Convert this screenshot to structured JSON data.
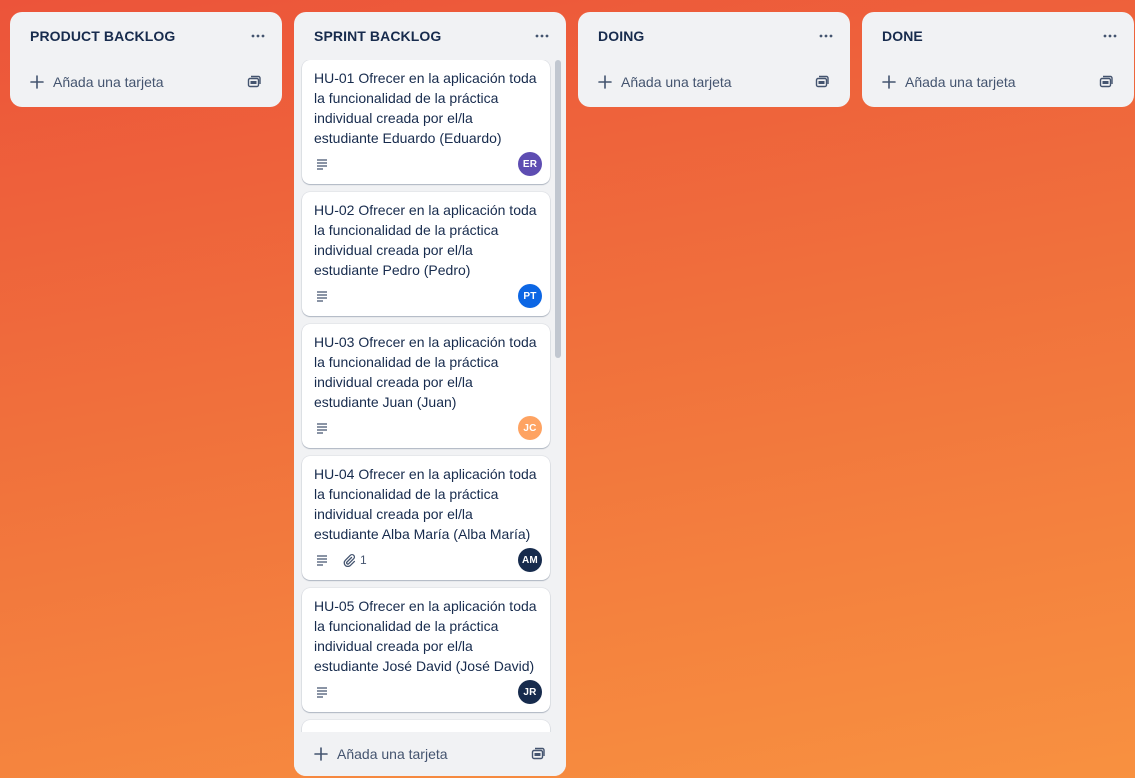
{
  "lists": [
    {
      "title": "PRODUCT BACKLOG",
      "add_label": "Añada una tarjeta"
    },
    {
      "title": "SPRINT BACKLOG",
      "add_label": "Añada una tarjeta",
      "cards": [
        {
          "title": "HU-01 Ofrecer en la aplicación toda la funcionalidad de la práctica individual creada por el/la estudiante Eduardo (Eduardo)",
          "avatar": "ER",
          "avatar_color": "#5e4db2"
        },
        {
          "title": "HU-02 Ofrecer en la aplicación toda la funcionalidad de la práctica individual creada por el/la estudiante Pedro (Pedro)",
          "avatar": "PT",
          "avatar_color": "#0c66e4"
        },
        {
          "title": "HU-03 Ofrecer en la aplicación toda la funcionalidad de la práctica individual creada por el/la estudiante Juan (Juan)",
          "avatar": "JC",
          "avatar_color": "#fea362"
        },
        {
          "title": "HU-04 Ofrecer en la aplicación toda la funcionalidad de la práctica individual creada por el/la estudiante Alba María (Alba María)",
          "avatar": "AM",
          "avatar_color": "#172b4d",
          "attachments": "1"
        },
        {
          "title": "HU-05 Ofrecer en la aplicación toda la funcionalidad de la práctica individual creada por el/la estudiante José David (José David)",
          "avatar": "JR",
          "avatar_color": "#172b4d"
        }
      ]
    },
    {
      "title": "DOING",
      "add_label": "Añada una tarjeta"
    },
    {
      "title": "DONE",
      "add_label": "Añada una tarjeta"
    }
  ],
  "icons": {
    "list_menu": "more-horizontal-icon",
    "add": "plus-icon",
    "template": "card-template-icon",
    "description": "description-icon",
    "attachment": "paperclip-icon"
  },
  "colors": {
    "background_start": "#ec543a",
    "background_end": "#f89140",
    "list_bg": "#f1f2f4",
    "card_bg": "#ffffff",
    "text": "#172b4d",
    "subtle_text": "#44546f"
  }
}
